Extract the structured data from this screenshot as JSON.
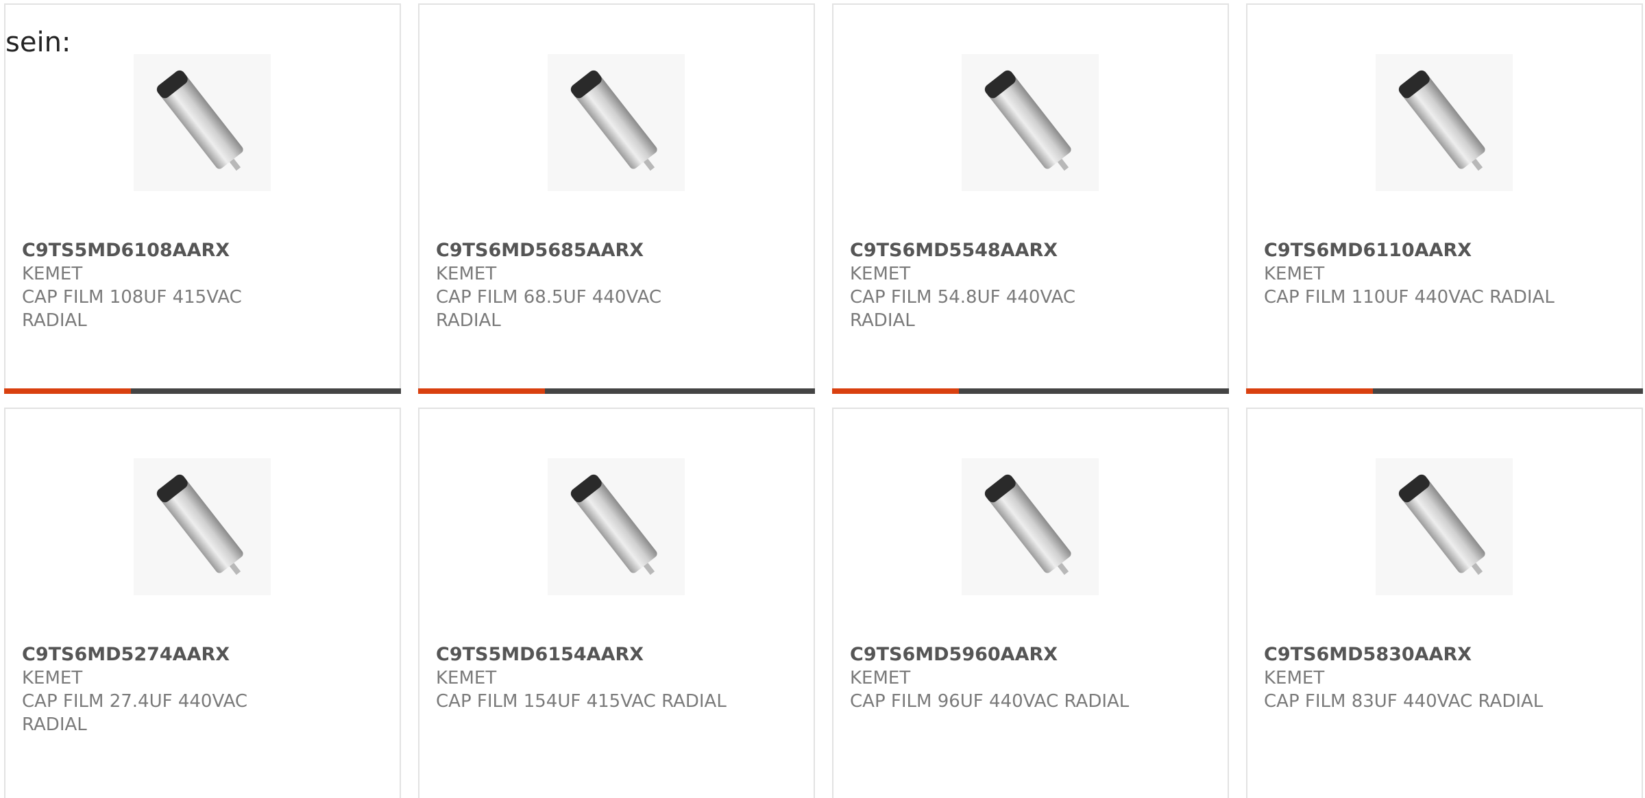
{
  "lead_text": "sein:",
  "colors": {
    "accent": "#d9400f",
    "bar": "#444444",
    "border": "#e2e2e2"
  },
  "products": [
    {
      "part": "C9TS5MD6108AARX",
      "maker": "KEMET",
      "desc": "CAP FILM 108UF 415VAC RADIAL",
      "image_icon": "capacitor-image"
    },
    {
      "part": "C9TS6MD5685AARX",
      "maker": "KEMET",
      "desc": "CAP FILM 68.5UF 440VAC RADIAL",
      "image_icon": "capacitor-image"
    },
    {
      "part": "C9TS6MD5548AARX",
      "maker": "KEMET",
      "desc": "CAP FILM 54.8UF 440VAC RADIAL",
      "image_icon": "capacitor-image"
    },
    {
      "part": "C9TS6MD6110AARX",
      "maker": "KEMET",
      "desc": "CAP FILM 110UF 440VAC RADIAL",
      "image_icon": "capacitor-image"
    },
    {
      "part": "C9TS6MD5274AARX",
      "maker": "KEMET",
      "desc": "CAP FILM 27.4UF 440VAC RADIAL",
      "image_icon": "capacitor-image"
    },
    {
      "part": "C9TS5MD6154AARX",
      "maker": "KEMET",
      "desc": "CAP FILM 154UF 415VAC RADIAL",
      "image_icon": "capacitor-image"
    },
    {
      "part": "C9TS6MD5960AARX",
      "maker": "KEMET",
      "desc": "CAP FILM 96UF 440VAC RADIAL",
      "image_icon": "capacitor-image"
    },
    {
      "part": "C9TS6MD5830AARX",
      "maker": "KEMET",
      "desc": "CAP FILM 83UF 440VAC RADIAL",
      "image_icon": "capacitor-image"
    }
  ]
}
